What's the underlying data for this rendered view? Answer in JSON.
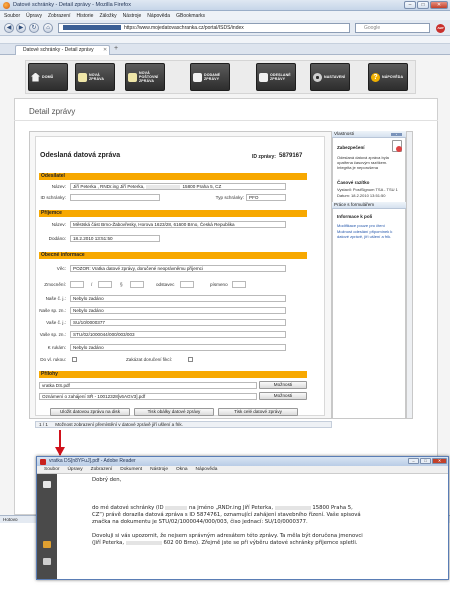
{
  "browser": {
    "title": "Datové schránky - Detail zprávy - Mozilla Firefox",
    "menu": [
      "Soubor",
      "Úpravy",
      "Zobrazení",
      "Historie",
      "Záložky",
      "Nástroje",
      "Nápověda",
      "GBookmarks"
    ],
    "url": "https://www.mojedatovaschranka.cz/portal/ISDS/index",
    "search_placeholder": "Google",
    "tab_label": "Datové schránky - Detail zprávy",
    "status": "Hotovo"
  },
  "toolbar": [
    {
      "label": "DOMŮ",
      "icon": "house-icon"
    },
    {
      "label": "NOVÁ ZPRÁVA",
      "icon": "new-message-icon"
    },
    {
      "label": "NOVÁ POŠTOVNÍ ZPRÁVA",
      "icon": "postal-message-icon"
    },
    {
      "label": "DODANÉ ZPRÁVY",
      "icon": "inbox-icon"
    },
    {
      "label": "ODESLANÉ ZPRÁVY",
      "icon": "outbox-icon"
    },
    {
      "label": "NASTAVENÍ",
      "icon": "gear-icon"
    },
    {
      "label": "NÁPOVĚDA",
      "icon": "help-icon"
    }
  ],
  "page": {
    "heading": "Detail zprávy",
    "doc_title": "Odeslaná datová zpráva",
    "id_label": "ID zprávy:",
    "id_value": "5879167"
  },
  "sections": {
    "sender": "Odesílatel",
    "recipient": "Příjemce",
    "general": "Obecné informace",
    "attachments": "Přílohy"
  },
  "sender": {
    "name_label": "Název:",
    "name_value_a": "Jiří Peterka , RNDr.ing Jiří Peterka,",
    "name_value_b": "15800 Praha 5, CZ",
    "id_label": "ID schránky:",
    "type_label": "Typ schránky:",
    "type_value": "PFO"
  },
  "recipient": {
    "name_label": "Název:",
    "name_value": "Městská část Brno-Žabovřesky, Horova 1623/28, 61600 Brno, Česká Republika",
    "date_label": "Dodáno:",
    "date_value": "18.2.2010 13:51:50"
  },
  "general": {
    "vec_label": "Věc:",
    "vec_value": "POZOR: Vratka datové zprávy, doručené neoprávněmu příjemci",
    "zmocneni_label": "Zmocnění:",
    "slash": "/",
    "para": "§",
    "odstavec": "odstavec",
    "pismeno": "písmeno",
    "cj_label": "Naše č. j.:",
    "cj_value": "Nebylo zadáno",
    "sz_label": "Naše sp. zn.:",
    "sz_value": "Nebylo zadáno",
    "vcj_label": "Vaše č. j.:",
    "vcj_value": "SU/10/0000377",
    "vsz_label": "Vaše sp. zn.:",
    "vsz_value": "STU/02/1000044/000/003/003",
    "rukam_label": "K rukám:",
    "rukam_value": "Nebylo zadáno",
    "dovl_label": "Do vl. rukou:",
    "zakaz_label": "Zakázat doručení fikcí:"
  },
  "attachments": [
    {
      "name": "vratka DS.pdf",
      "action": "Možnosti"
    },
    {
      "name": "Oznámení o zahájení SŘ - 10012328[v6AGV3].pdf",
      "action": "Možnosti"
    }
  ],
  "buttons": {
    "save_disk": "Uložit datovou zprávu na disk",
    "print_pdf": "Tisk obálky datové zprávy",
    "print_all": "Tisk celé datové zprávy"
  },
  "sidebar": {
    "header": "Vlastnosti",
    "secure_title": "Zabezpečení",
    "secure_text": "Odeslaná datová zpráva byla opatřena časovým razítkem. Integrita je neporušena",
    "timestamp_title": "Časové razítko",
    "ts_issuer": "Vystavil: PostSignum TSA - TSU 1",
    "ts_date": "Datum: 18.2.2010 13:51:50",
    "work_header": "Práce s formulářem",
    "info_title": "Informace k poli",
    "info_link1": "Modifikace pouze pro čtení",
    "info_link2": "Možnost odeslání připomínek k datové zprávě, jiří ušlení a frik."
  },
  "inner_status": "1 / 1",
  "inner_status_text": "Možnost zobrazení přemístění v datové zprávě jiří ušlení a frik.",
  "reader": {
    "title": "vratka DS[n8YFuJ].pdf - Adobe Reader",
    "menu": [
      "Soubor",
      "Úpravy",
      "Zobrazení",
      "Dokument",
      "Nástroje",
      "Okna",
      "Nápověda"
    ],
    "greeting": "Dobrý den,",
    "p1_a": "do mé datové schránky (ID",
    "p1_b": "na jméno „RNDr.ing Jiří Peterka,",
    "p1_c": "15800 Praha 5,",
    "p1_d": "CZ“) právě dorazila datová zpráva s ID 5874761, oznamující zahájení stavebního řízení. Vaše spisová",
    "p1_e": "značka na dokumentu je STU/02/1000044/000/003, čiso jednací: SU/10/0000377.",
    "p2_a": "Dovoluji si vás upozornit, že nejsem správným adresátem této zprávy. Ta měla být doručena jmenovci",
    "p2_b": "(Jiří Peterka,",
    "p2_c": "602 00 Brno). Zřejmě jste se při výběru datové schránky příjemce spletli."
  }
}
